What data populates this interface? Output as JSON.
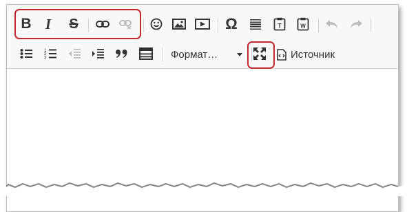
{
  "toolbar": {
    "row1": [
      {
        "name": "bold-button",
        "glyph": "B",
        "disabled": false
      },
      {
        "name": "italic-button",
        "glyph": "I",
        "disabled": false
      },
      {
        "name": "strikethrough-button",
        "glyph": "S",
        "disabled": false
      },
      {
        "name": "link-button",
        "icon": "link-icon",
        "disabled": false
      },
      {
        "name": "unlink-button",
        "icon": "unlink-icon",
        "disabled": true
      },
      {
        "name": "smiley-button",
        "icon": "smiley-icon",
        "disabled": false
      },
      {
        "name": "image-button",
        "icon": "image-icon",
        "disabled": false
      },
      {
        "name": "media-button",
        "icon": "media-icon",
        "disabled": false
      },
      {
        "name": "special-char-button",
        "glyph": "Ω",
        "disabled": false
      },
      {
        "name": "horizontal-rule-button",
        "icon": "hr-icon",
        "disabled": false
      },
      {
        "name": "paste-text-button",
        "icon": "paste-text-icon",
        "disabled": false
      },
      {
        "name": "paste-word-button",
        "icon": "paste-word-icon",
        "disabled": false
      },
      {
        "name": "undo-button",
        "icon": "undo-icon",
        "disabled": true
      },
      {
        "name": "redo-button",
        "icon": "redo-icon",
        "disabled": true
      }
    ],
    "row2": [
      {
        "name": "bulleted-list-button",
        "icon": "bulleted-list-icon"
      },
      {
        "name": "numbered-list-button",
        "icon": "numbered-list-icon"
      },
      {
        "name": "outdent-button",
        "icon": "outdent-icon"
      },
      {
        "name": "indent-button",
        "icon": "indent-icon"
      },
      {
        "name": "blockquote-button",
        "icon": "quote-icon"
      },
      {
        "name": "table-button",
        "icon": "table-icon"
      }
    ],
    "format_label": "Формат…",
    "source_label": "Источник"
  },
  "highlight_color": "#c1272d",
  "text_color": "#333333",
  "disabled_color": "#bdbdbd"
}
